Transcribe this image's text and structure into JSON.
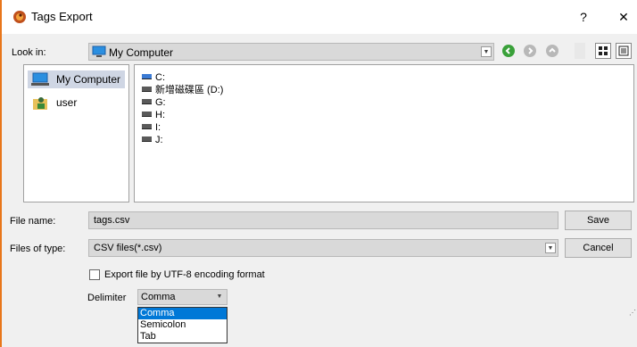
{
  "window": {
    "title": "Tags Export",
    "help_label": "?",
    "close_label": "✕"
  },
  "look_in": {
    "label": "Look in:",
    "value": "My Computer"
  },
  "sidebar": {
    "items": [
      {
        "label": "My Computer",
        "selected": true
      },
      {
        "label": "user",
        "selected": false
      }
    ]
  },
  "drives": [
    {
      "label": "C:"
    },
    {
      "label": "新增磁碟區 (D:)"
    },
    {
      "label": "G:"
    },
    {
      "label": "H:"
    },
    {
      "label": "I:"
    },
    {
      "label": "J:"
    }
  ],
  "file_name": {
    "label": "File name:",
    "value": "tags.csv"
  },
  "file_type": {
    "label": "Files of type:",
    "value": "CSV files(*.csv)"
  },
  "buttons": {
    "save": "Save",
    "cancel": "Cancel"
  },
  "utf8": {
    "label": "Export file by UTF-8 encoding format",
    "checked": false
  },
  "delimiter": {
    "label": "Delimiter",
    "value": "Comma",
    "options": [
      "Comma",
      "Semicolon",
      "Tab"
    ]
  },
  "colors": {
    "accent": "#0078d7",
    "border": "#e8761a"
  }
}
